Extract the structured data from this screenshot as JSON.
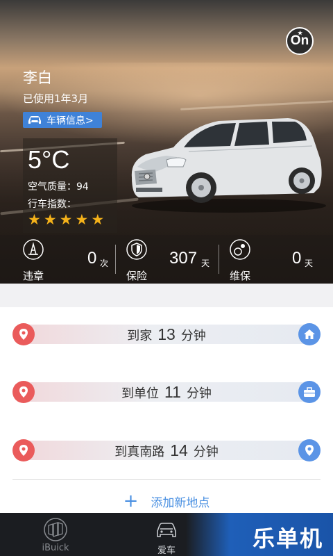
{
  "header": {
    "on_badge": "On",
    "user_name": "李白",
    "usage_text": "已使用1年3月",
    "vehicle_info_button": "车辆信息>"
  },
  "weather": {
    "temperature": "5°C",
    "air_quality": "空气质量：94",
    "driving_index_label": "行车指数：",
    "driving_index_stars": 5
  },
  "stats": [
    {
      "label": "违章",
      "value": "0",
      "unit": "次",
      "icon": "traffic-cone-icon"
    },
    {
      "label": "保险",
      "value": "307",
      "unit": "天",
      "icon": "shield-icon"
    },
    {
      "label": "维保",
      "value": "0",
      "unit": "天",
      "icon": "maintenance-icon"
    }
  ],
  "destinations": [
    {
      "prefix": "到家",
      "minutes": "13",
      "suffix": "分钟",
      "icon": "home-icon"
    },
    {
      "prefix": "到单位",
      "minutes": "11",
      "suffix": "分钟",
      "icon": "briefcase-icon"
    },
    {
      "prefix": "到真南路",
      "minutes": "14",
      "suffix": "分钟",
      "icon": "location-pin-icon"
    }
  ],
  "add_place": "添加新地点",
  "tabs": [
    {
      "label": "iBuick",
      "icon": "buick-logo-icon",
      "active": false
    },
    {
      "label": "爱车",
      "icon": "car-icon",
      "active": true
    }
  ],
  "watermark_text": "乐单机",
  "colors": {
    "accent_blue": "#3f82d8",
    "pin_red": "#ea5b5b",
    "icon_blue": "#5b94e6",
    "star_gold": "#f5b21a",
    "tabbar_bg": "#1b1d21"
  }
}
